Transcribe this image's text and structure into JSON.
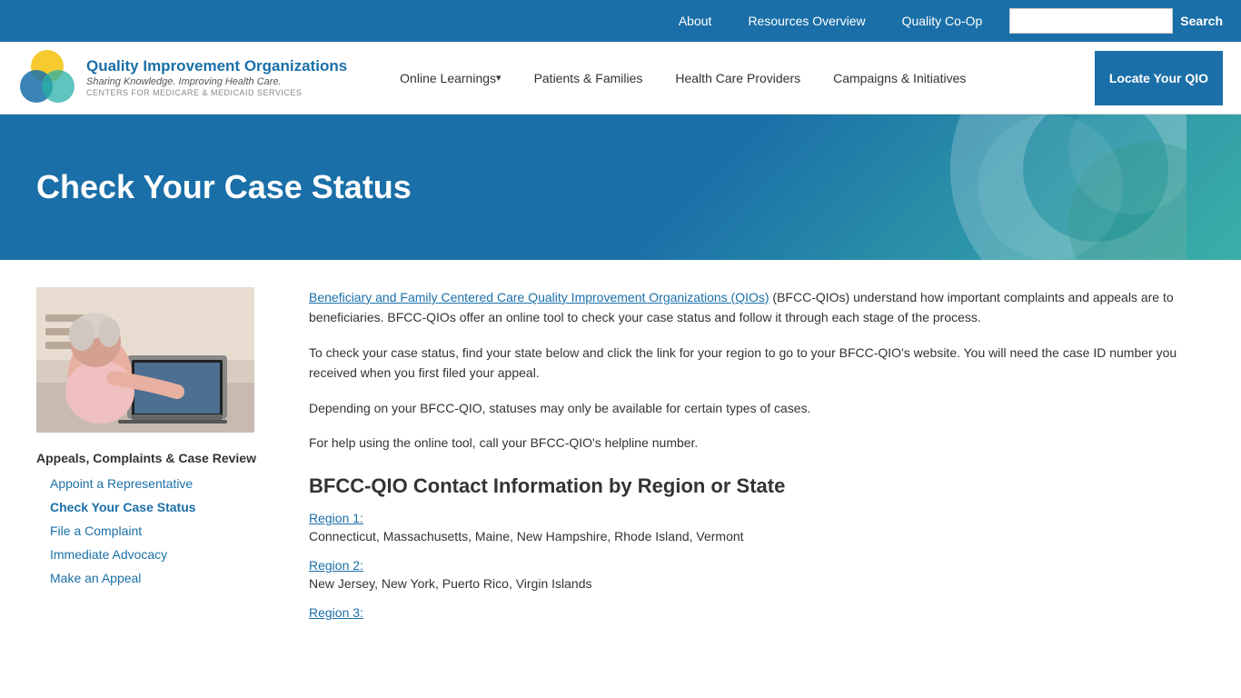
{
  "topbar": {
    "links": [
      {
        "id": "about",
        "label": "About"
      },
      {
        "id": "resources",
        "label": "Resources Overview"
      },
      {
        "id": "quality",
        "label": "Quality Co-Op"
      }
    ],
    "search_placeholder": "",
    "search_button": "Search"
  },
  "navbar": {
    "logo": {
      "org_name": "Quality Improvement Organizations",
      "tagline": "Sharing Knowledge. Improving Health Care.",
      "centers": "Centers for Medicare & Medicaid Services"
    },
    "nav_items": [
      {
        "id": "online-learnings",
        "label": "Online Learnings",
        "dropdown": true
      },
      {
        "id": "patients-families",
        "label": "Patients & Families",
        "dropdown": false
      },
      {
        "id": "health-care-providers",
        "label": "Health Care Providers",
        "dropdown": false
      },
      {
        "id": "campaigns-initiatives",
        "label": "Campaigns & Initiatives",
        "dropdown": false
      }
    ],
    "locate_btn": "Locate Your QIO"
  },
  "hero": {
    "title": "Check Your Case Status"
  },
  "sidebar": {
    "nav_title": "Appeals, Complaints & Case Review",
    "nav_links": [
      {
        "id": "appoint",
        "label": "Appoint a Representative",
        "active": false
      },
      {
        "id": "check-status",
        "label": "Check Your Case Status",
        "active": true
      },
      {
        "id": "file-complaint",
        "label": "File a Complaint",
        "active": false
      },
      {
        "id": "immediate-advocacy",
        "label": "Immediate Advocacy",
        "active": false
      },
      {
        "id": "make-appeal",
        "label": "Make an Appeal",
        "active": false
      }
    ]
  },
  "content": {
    "intro_link_text": "Beneficiary and Family Centered Care Quality Improvement Organizations (QIOs)",
    "intro_p1": " (BFCC-QIOs) understand how important complaints and appeals are to beneficiaries. BFCC-QIOs offer an online tool to check your case status and follow it through each stage of the process.",
    "intro_p2": "To check your case status, find your state below and click the link for your region to go to your BFCC-QIO's website. You will need the case ID number you received when you first filed your appeal.",
    "intro_p3": "Depending on your BFCC-QIO, statuses may only be available for certain types of cases.",
    "intro_p4": "For help using the online tool, call your BFCC-QIO's helpline number.",
    "section_title": "BFCC-QIO Contact Information by Region or State",
    "regions": [
      {
        "id": "region-1",
        "label": "Region 1:",
        "states": "Connecticut, Massachusetts, Maine, New Hampshire, Rhode Island, Vermont"
      },
      {
        "id": "region-2",
        "label": "Region 2:",
        "states": "New Jersey, New York, Puerto Rico, Virgin Islands"
      },
      {
        "id": "region-3",
        "label": "Region 3:",
        "states": ""
      }
    ]
  }
}
